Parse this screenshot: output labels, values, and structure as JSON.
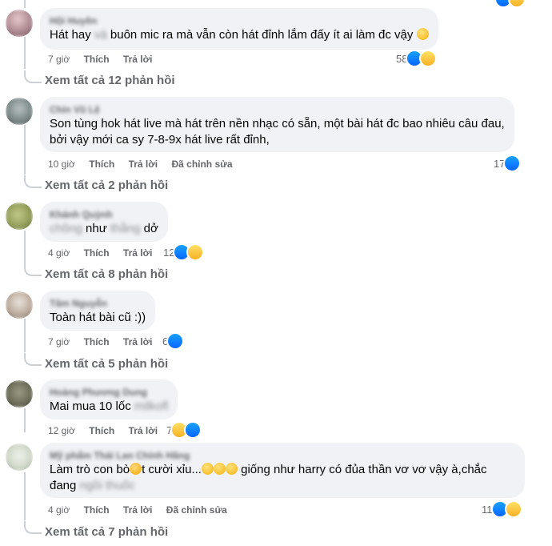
{
  "actions_labels": {
    "like": "Thích",
    "reply": "Trả lời",
    "edited": "Đã chỉnh sửa"
  },
  "comments": [
    {
      "name": "Hội Huyền",
      "text_a": "Hát hay ",
      "text_blur": "và",
      "text_b": " buôn mic ra mà vẫn còn hát đỉnh lắm đấy ít ai làm đc vậy",
      "time": "7 giờ",
      "count": "58",
      "view_more": "Xem tất cả 12 phản hồi",
      "avatar_color": "#a8848c"
    },
    {
      "name": "Chín Vũ Lệ",
      "text_line1": "Son tùng hok hát live mà hát trên nền nhạc có sẵn, một bài hát đc bao nhiêu câu đau,",
      "text_line2": "bởi vậy mới ca sy 7-8-9x hát live rất đỉnh,",
      "time": "10 giờ",
      "count": "17",
      "view_more": "Xem tất cả 2 phản hồi",
      "avatar_color": "#7d8a8a"
    },
    {
      "name": "Khánh Quỳnh",
      "text_blur_a": "chồng",
      "text_a": " như ",
      "text_blur_b": "thằng",
      "text_b": " dở",
      "time": "4 giờ",
      "count": "12",
      "view_more": "Xem tất cả 8 phản hồi",
      "avatar_color": "#95a05a"
    },
    {
      "name": "Tâm Nguyễn",
      "text": "Toàn hát bài cũ :))",
      "time": "7 giờ",
      "count": "6",
      "view_more": "Xem tất cả 5 phản hồi",
      "avatar_color": "#b8a89a"
    },
    {
      "name": "Hoàng Phương Dung",
      "text_a": "Mai mua 10 lốc ",
      "text_blur": "milkofl",
      "time": "12 giờ",
      "count": "7",
      "avatar_color": "#6e6e5a"
    },
    {
      "name": "Mỹ phẩm Thái Lan Chính Hãng",
      "text_a": "Làm trò con bò",
      "text_b": "t cười xỉu...",
      "text_c": " giống như harry có đủa thần vơ vơ vậy à,chắc",
      "text_d": "đang ",
      "text_blur": "ngồi thuốc",
      "time": "4 giờ",
      "count": "11",
      "view_more": "Xem tất cả 7 phản hồi",
      "avatar_color": "#cfd7c8"
    }
  ],
  "colors": {
    "like": "#0866ff",
    "haha": "#f7b125",
    "bubble": "#f0f2f5",
    "muted": "#65676b"
  }
}
